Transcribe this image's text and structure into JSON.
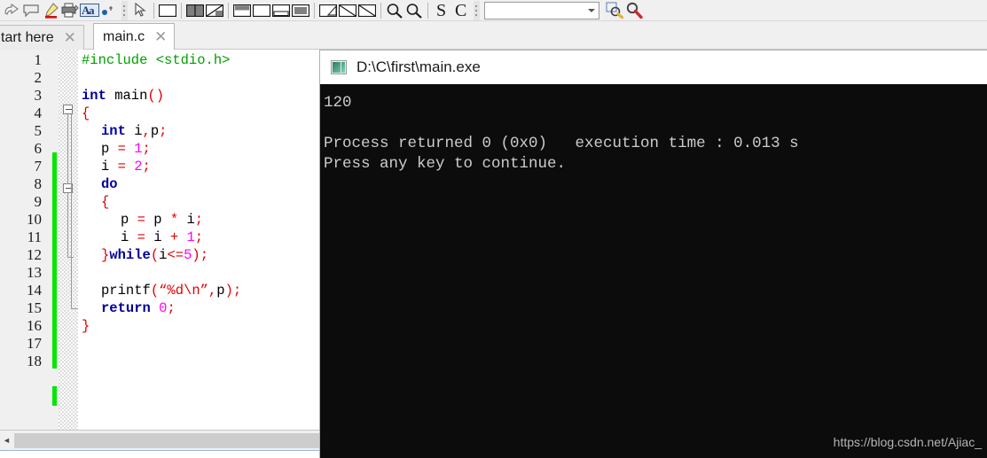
{
  "toolbar": {
    "icons": [
      {
        "name": "redo-icon"
      },
      {
        "name": "comment-icon"
      },
      {
        "name": "highlighter-icon"
      },
      {
        "name": "print-icon"
      },
      {
        "name": "abc-style-icon"
      },
      {
        "name": "breakpoint-icon"
      }
    ],
    "icons2": [
      {
        "name": "pointer-icon"
      },
      {
        "name": "panel-blank-icon"
      },
      {
        "name": "panel-split-icon"
      },
      {
        "name": "panel-diagonal-icon"
      },
      {
        "name": "panel-top-icon"
      },
      {
        "name": "panel-empty-icon"
      },
      {
        "name": "panel-bottom-icon"
      },
      {
        "name": "panel-filled-icon"
      }
    ],
    "icons3": [
      {
        "name": "triangle-a-icon"
      },
      {
        "name": "triangle-b-icon"
      },
      {
        "name": "triangle-c-icon"
      },
      {
        "name": "zoom-out-icon"
      },
      {
        "name": "zoom-in-icon"
      },
      {
        "name": "letter-s-icon"
      },
      {
        "name": "letter-c-icon"
      }
    ],
    "combo_value": "",
    "icons4": [
      {
        "name": "find-yellow-icon"
      },
      {
        "name": "find-red-icon"
      }
    ]
  },
  "tabs": [
    {
      "label": "tart here",
      "close": "✕",
      "active": false
    },
    {
      "label": "main.c",
      "close": "✕",
      "active": true
    }
  ],
  "editor": {
    "line_numbers": [
      "1",
      "2",
      "3",
      "4",
      "5",
      "6",
      "7",
      "8",
      "9",
      "10",
      "11",
      "12",
      "13",
      "14",
      "15",
      "16",
      "17",
      "18"
    ],
    "lines": [
      {
        "n": 1,
        "segments": [
          {
            "t": "#include <stdio.h>",
            "c": "pre"
          }
        ],
        "indent": 0
      },
      {
        "n": 2,
        "segments": [],
        "indent": 0
      },
      {
        "n": 3,
        "segments": [
          {
            "t": "int",
            "c": "kw"
          },
          {
            "t": " main",
            "c": "plain"
          },
          {
            "t": "()",
            "c": "punc"
          }
        ],
        "indent": 0
      },
      {
        "n": 4,
        "segments": [
          {
            "t": "{",
            "c": "punc"
          }
        ],
        "indent": 0
      },
      {
        "n": 5,
        "segments": [
          {
            "t": "int",
            "c": "kw"
          },
          {
            "t": " i",
            "c": "plain"
          },
          {
            "t": ",",
            "c": "punc"
          },
          {
            "t": "p",
            "c": "plain"
          },
          {
            "t": ";",
            "c": "punc"
          }
        ],
        "indent": 1
      },
      {
        "n": 6,
        "segments": [
          {
            "t": "p ",
            "c": "plain"
          },
          {
            "t": "=",
            "c": "punc"
          },
          {
            "t": " ",
            "c": "plain"
          },
          {
            "t": "1",
            "c": "num"
          },
          {
            "t": ";",
            "c": "punc"
          }
        ],
        "indent": 1
      },
      {
        "n": 7,
        "segments": [
          {
            "t": "i ",
            "c": "plain"
          },
          {
            "t": "=",
            "c": "punc"
          },
          {
            "t": " ",
            "c": "plain"
          },
          {
            "t": "2",
            "c": "num"
          },
          {
            "t": ";",
            "c": "punc"
          }
        ],
        "indent": 1
      },
      {
        "n": 8,
        "segments": [
          {
            "t": "do",
            "c": "kw"
          }
        ],
        "indent": 1
      },
      {
        "n": 9,
        "segments": [
          {
            "t": "{",
            "c": "punc"
          }
        ],
        "indent": 1
      },
      {
        "n": 10,
        "segments": [
          {
            "t": "p ",
            "c": "plain"
          },
          {
            "t": "=",
            "c": "punc"
          },
          {
            "t": " p ",
            "c": "plain"
          },
          {
            "t": "*",
            "c": "punc"
          },
          {
            "t": " i",
            "c": "plain"
          },
          {
            "t": ";",
            "c": "punc"
          }
        ],
        "indent": 2
      },
      {
        "n": 11,
        "segments": [
          {
            "t": "i ",
            "c": "plain"
          },
          {
            "t": "=",
            "c": "punc"
          },
          {
            "t": " i ",
            "c": "plain"
          },
          {
            "t": "+",
            "c": "punc"
          },
          {
            "t": " ",
            "c": "plain"
          },
          {
            "t": "1",
            "c": "num"
          },
          {
            "t": ";",
            "c": "punc"
          }
        ],
        "indent": 2
      },
      {
        "n": 12,
        "segments": [
          {
            "t": "}",
            "c": "punc"
          },
          {
            "t": "while",
            "c": "kw"
          },
          {
            "t": "(",
            "c": "punc"
          },
          {
            "t": "i",
            "c": "plain"
          },
          {
            "t": "<=",
            "c": "punc"
          },
          {
            "t": "5",
            "c": "num"
          },
          {
            "t": ")",
            "c": "punc"
          },
          {
            "t": ";",
            "c": "punc"
          }
        ],
        "indent": 1
      },
      {
        "n": 13,
        "segments": [],
        "indent": 0
      },
      {
        "n": 14,
        "segments": [
          {
            "t": "printf",
            "c": "plain"
          },
          {
            "t": "(",
            "c": "punc"
          },
          {
            "t": "“%d\\n”",
            "c": "str"
          },
          {
            "t": ",",
            "c": "punc"
          },
          {
            "t": "p",
            "c": "plain"
          },
          {
            "t": ")",
            "c": "punc"
          },
          {
            "t": ";",
            "c": "punc"
          }
        ],
        "indent": 1
      },
      {
        "n": 15,
        "segments": [
          {
            "t": "return",
            "c": "kw"
          },
          {
            "t": " ",
            "c": "plain"
          },
          {
            "t": "0",
            "c": "num"
          },
          {
            "t": ";",
            "c": "punc"
          }
        ],
        "indent": 1
      },
      {
        "n": 16,
        "segments": [
          {
            "t": "}",
            "c": "punc"
          }
        ],
        "indent": 0
      },
      {
        "n": 17,
        "segments": [],
        "indent": 0
      },
      {
        "n": 18,
        "segments": [],
        "indent": 0
      }
    ],
    "colors": {
      "keyword": "#00009b",
      "preprocessor": "#00a000",
      "string": "#e00000",
      "number": "#ff00ff",
      "punctuation": "#e00000",
      "change_marker": "#00e800"
    },
    "scrollbar": {
      "left_arrow": "◄",
      "right_arrow": "►"
    }
  },
  "console": {
    "title": "D:\\C\\first\\main.exe",
    "icon": "console-window-icon",
    "output": [
      "120",
      "",
      "Process returned 0 (0x0)   execution time : 0.013 s",
      "Press any key to continue."
    ],
    "background": "#0c0c0c",
    "text_color": "#cccccc"
  },
  "watermark": "https://blog.csdn.net/Ajiac_"
}
